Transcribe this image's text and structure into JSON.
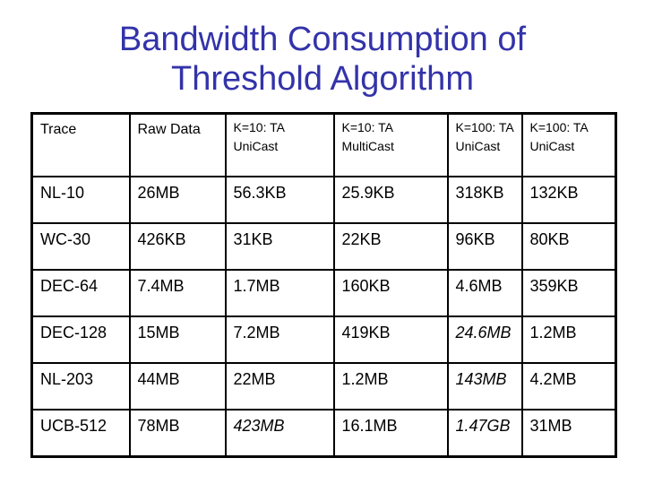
{
  "slide": {
    "title_line1": "Bandwidth Consumption of",
    "title_line2": "Threshold Algorithm",
    "title_color": "#3333aa"
  },
  "table": {
    "headers": [
      "Trace",
      "Raw Data",
      "K=10: TA UniCast",
      "K=10: TA MultiCast",
      "K=100: TA UniCast",
      "K=100: TA UniCast"
    ],
    "rows": [
      {
        "cells": [
          "NL-10",
          "26MB",
          "56.3KB",
          "25.9KB",
          "318KB",
          "132KB"
        ],
        "italic": [
          false,
          false,
          false,
          false,
          false,
          false
        ]
      },
      {
        "cells": [
          "WC-30",
          "426KB",
          "31KB",
          "22KB",
          "96KB",
          "80KB"
        ],
        "italic": [
          false,
          false,
          false,
          false,
          false,
          false
        ]
      },
      {
        "cells": [
          "DEC-64",
          "7.4MB",
          "1.7MB",
          "160KB",
          "4.6MB",
          "359KB"
        ],
        "italic": [
          false,
          false,
          false,
          false,
          false,
          false
        ]
      },
      {
        "cells": [
          "DEC-128",
          "15MB",
          "7.2MB",
          "419KB",
          "24.6MB",
          "1.2MB"
        ],
        "italic": [
          false,
          false,
          false,
          false,
          true,
          false
        ]
      },
      {
        "cells": [
          "NL-203",
          "44MB",
          "22MB",
          "1.2MB",
          "143MB",
          "4.2MB"
        ],
        "italic": [
          false,
          false,
          false,
          false,
          true,
          false
        ]
      },
      {
        "cells": [
          "UCB-512",
          "78MB",
          "423MB",
          "16.1MB",
          "1.47GB",
          "31MB"
        ],
        "italic": [
          false,
          false,
          true,
          false,
          true,
          false
        ]
      }
    ]
  }
}
